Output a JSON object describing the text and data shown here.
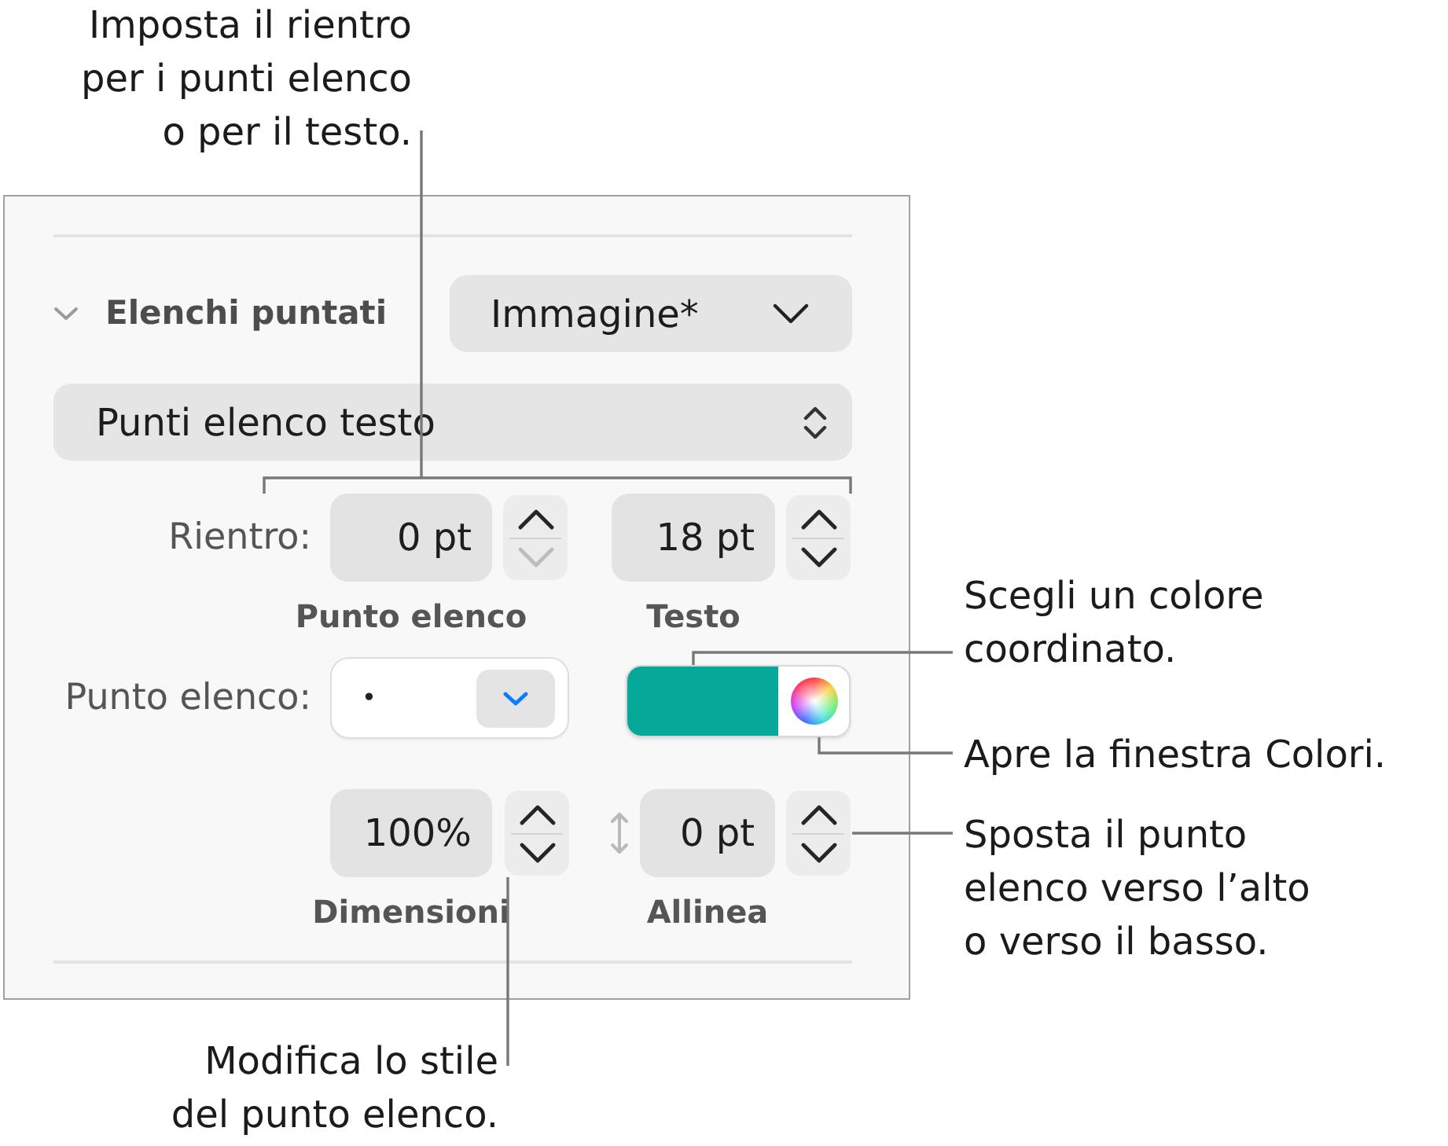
{
  "callouts": [
    {
      "lines": [
        "Imposta il rientro",
        "per i punti elenco",
        "o per il testo."
      ]
    },
    {
      "lines": [
        "Scegli un colore",
        "coordinato."
      ]
    },
    {
      "lines": [
        "Apre la finestra Colori."
      ]
    },
    {
      "lines": [
        "Sposta il punto",
        "elenco verso l’alto",
        "o verso il basso."
      ]
    },
    {
      "lines": [
        "Modifica lo stile",
        "del punto elenco."
      ]
    }
  ],
  "panel": {
    "section": {
      "title": "Elenchi puntati",
      "expanded": true
    },
    "bullet_type": {
      "value": "Immagine*"
    },
    "bullet_style": {
      "value": "Punti elenco testo"
    },
    "indent": {
      "label": "Rientro:",
      "fields": [
        {
          "value": "0 pt",
          "caption": "Punto elenco",
          "up_disabled": false,
          "down_disabled": true
        },
        {
          "value": "18 pt",
          "caption": "Testo",
          "up_disabled": false,
          "down_disabled": false
        }
      ]
    },
    "bullet": {
      "label": "Punto elenco:",
      "value": "•",
      "color": "#05a899"
    },
    "size": {
      "value": "100%",
      "caption": "Dimensioni",
      "up_disabled": false,
      "down_disabled": false
    },
    "align": {
      "value": "0 pt",
      "caption": "Allinea",
      "up_disabled": false,
      "down_disabled": false
    }
  }
}
